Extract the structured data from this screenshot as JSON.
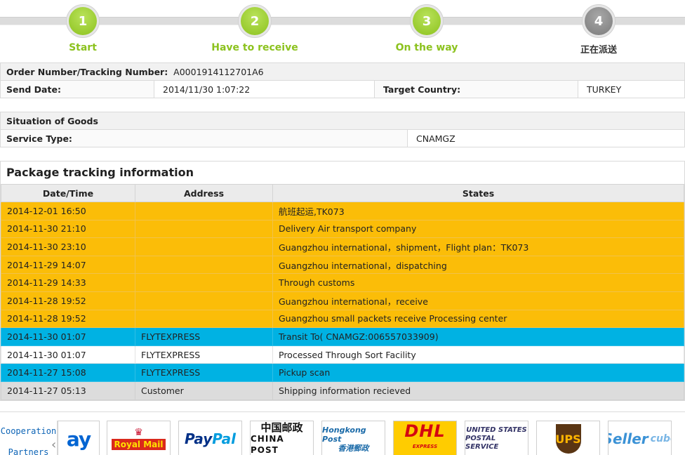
{
  "steps": [
    {
      "num": "1",
      "label": "Start",
      "state": "done"
    },
    {
      "num": "2",
      "label": "Have to receive",
      "state": "done"
    },
    {
      "num": "3",
      "label": "On the way",
      "state": "done"
    },
    {
      "num": "4",
      "label": "正在派送",
      "state": "current"
    }
  ],
  "order": {
    "number_label": "Order Number/Tracking Number:",
    "number_value": "A0001914112701A6",
    "send_date_label": "Send Date:",
    "send_date_value": "2014/11/30 1:07:22",
    "target_country_label": "Target Country:",
    "target_country_value": "TURKEY"
  },
  "goods": {
    "situation_label": "Situation of Goods",
    "service_type_label": "Service Type:",
    "service_type_value": "CNAMGZ"
  },
  "tracking": {
    "title": "Package tracking information",
    "headers": [
      "Date/Time",
      "Address",
      "States"
    ],
    "rows": [
      {
        "date": "2014-12-01 16:50",
        "address": "",
        "state": "航班起运,TK073",
        "color": "orange"
      },
      {
        "date": "2014-11-30 21:10",
        "address": "",
        "state": "Delivery Air transport company",
        "color": "orange"
      },
      {
        "date": "2014-11-30 23:10",
        "address": "",
        "state": "Guangzhou international，shipment，Flight plan：TK073",
        "color": "orange"
      },
      {
        "date": "2014-11-29 14:07",
        "address": "",
        "state": "Guangzhou international，dispatching",
        "color": "orange"
      },
      {
        "date": "2014-11-29 14:33",
        "address": "",
        "state": "Through customs",
        "color": "orange"
      },
      {
        "date": "2014-11-28 19:52",
        "address": "",
        "state": "Guangzhou international，receive",
        "color": "orange"
      },
      {
        "date": "2014-11-28 19:52",
        "address": "",
        "state": "Guangzhou small packets receive Processing center",
        "color": "orange"
      },
      {
        "date": "2014-11-30 01:07",
        "address": "FLYTEXPRESS",
        "state": "Transit To( CNAMGZ:006557033909)",
        "color": "blue"
      },
      {
        "date": "2014-11-30 01:07",
        "address": "FLYTEXPRESS",
        "state": "Processed Through Sort Facility",
        "color": "white"
      },
      {
        "date": "2014-11-27 15:08",
        "address": "FLYTEXPRESS",
        "state": "Pickup scan",
        "color": "blue"
      },
      {
        "date": "2014-11-27 05:13",
        "address": "Customer",
        "state": "Shipping information recieved",
        "color": "grey"
      }
    ]
  },
  "partners": {
    "title_line1": "Cooperation",
    "title_line2": "Partners",
    "logos": {
      "ebay": "ay",
      "royal_mail": "Royal Mail",
      "paypal_1": "Pay",
      "paypal_2": "Pal",
      "china_post_cn": "中国邮政",
      "china_post_en": "CHINA POST",
      "hongkong_post_en": "Hongkong Post",
      "hongkong_post_cn": "香港郵政",
      "dhl": "DHL",
      "dhl_sub": "EXPRESS",
      "usps_1": "UNITED STATES",
      "usps_2": "POSTAL SERVICE",
      "ups": "UPS",
      "seller": "Seller",
      "cube": "cube"
    }
  }
}
